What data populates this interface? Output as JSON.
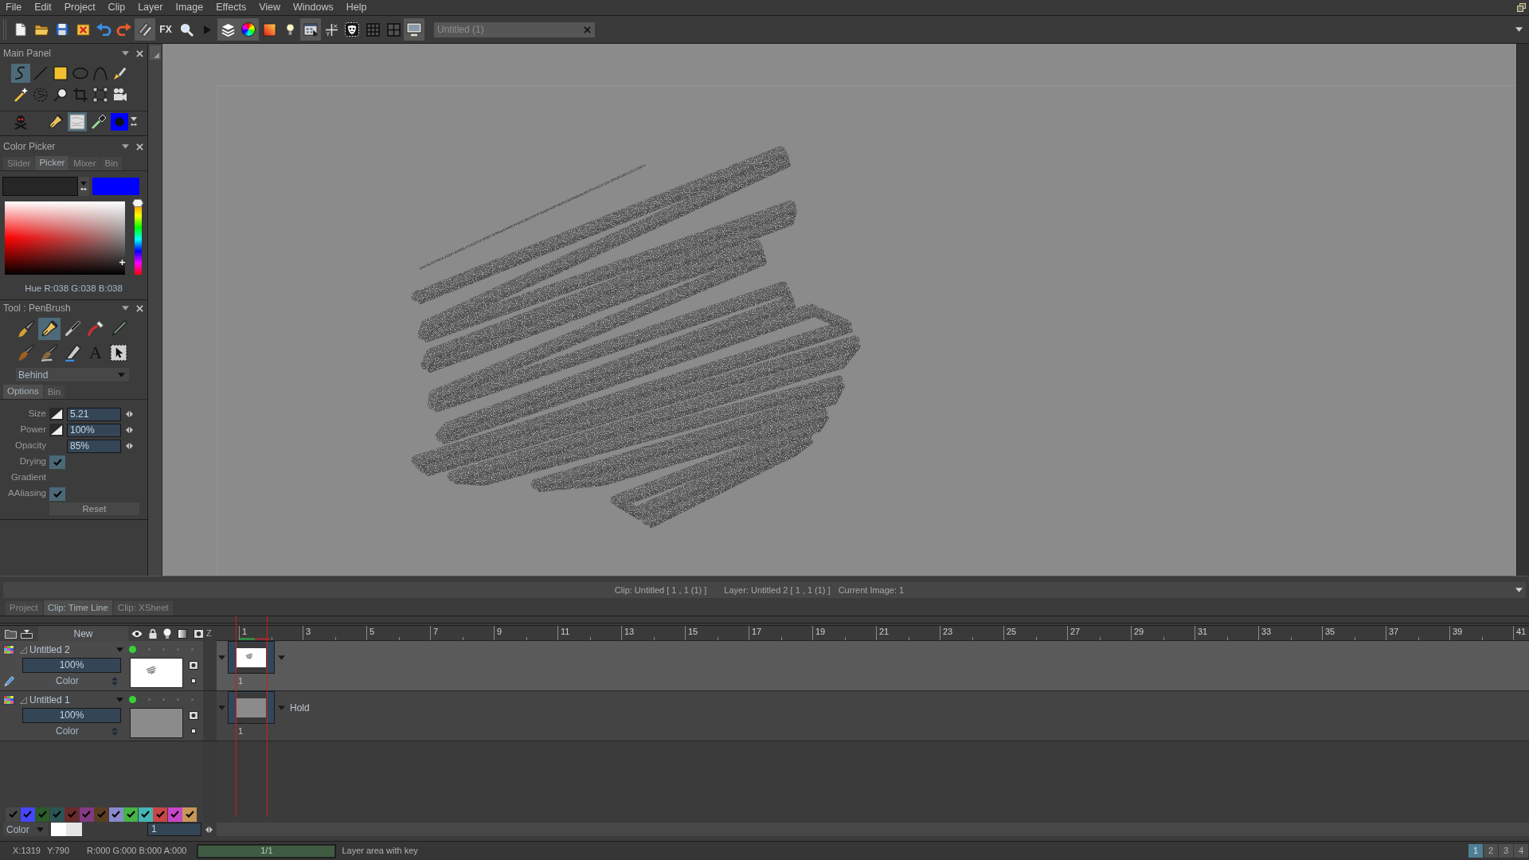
{
  "menu_bar": {
    "items": [
      "File",
      "Edit",
      "Project",
      "Clip",
      "Layer",
      "Image",
      "Effects",
      "View",
      "Windows",
      "Help"
    ]
  },
  "toolbar": {
    "buttons": [
      {
        "on": false
      },
      {
        "on": false
      },
      {
        "on": false
      },
      {
        "on": false
      },
      {
        "on": false
      },
      {
        "on": false
      },
      {
        "on": true
      },
      {
        "label": "FX",
        "on": false
      },
      {
        "on": false
      },
      {
        "on": false
      },
      {
        "on": true
      },
      {
        "on": true
      },
      {
        "on": false
      },
      {
        "on": false
      },
      {
        "on": true
      },
      {
        "on": false
      },
      {
        "on": false
      },
      {
        "on": false
      },
      {
        "on": false
      },
      {
        "on": true
      }
    ],
    "document_tab": {
      "title": "Untitled (1)"
    }
  },
  "main_panel": {
    "title": "Main Panel",
    "tool_rows": [
      [
        {
          "selected": true
        },
        {
          "selected": false
        },
        {
          "selected": false
        },
        {
          "selected": false
        },
        {
          "selected": false
        },
        {
          "selected": false
        }
      ],
      [
        {
          "selected": false
        },
        {
          "selected": false
        },
        {
          "selected": false
        },
        {
          "selected": false
        },
        {
          "selected": false
        },
        {
          "selected": false
        }
      ],
      [
        {
          "selected": false
        },
        {
          "selected": false
        },
        {
          "selected": true
        },
        {
          "selected": false
        },
        {
          "color": "#0000ff"
        }
      ]
    ]
  },
  "color_picker": {
    "title": "Color Picker",
    "tabs": [
      {
        "label": "Slider",
        "selected": false
      },
      {
        "label": "Picker",
        "selected": true
      },
      {
        "label": "Mixer",
        "selected": false
      },
      {
        "label": "Bin",
        "selected": false
      }
    ],
    "colors": [
      {
        "color": "#262626",
        "selected": true
      },
      {
        "color": "#0000ff",
        "selected": false
      }
    ],
    "hue_slider": {
      "level": 1
    },
    "readout": "Hue R:038 G:038 B:038"
  },
  "tool_panel": {
    "title": "Tool : PenBrush",
    "brush_rows": [
      [
        {
          "selected": false
        },
        {
          "selected": true
        },
        {
          "selected": false
        },
        {
          "selected": false
        },
        {
          "selected": false
        }
      ],
      [
        {
          "selected": false
        },
        {
          "selected": false
        },
        {
          "selected": false
        },
        {
          "label": "A",
          "selected": false
        },
        {
          "selected": false
        }
      ]
    ],
    "mode": "Behind",
    "tabs": [
      {
        "label": "Options",
        "selected": true
      },
      {
        "label": "Bin",
        "selected": false
      }
    ],
    "options": [
      {
        "kind": "field",
        "label": "Size",
        "value": "5.21",
        "pressure": true
      },
      {
        "kind": "field",
        "label": "Power",
        "value": "100%",
        "pressure": true
      },
      {
        "kind": "field",
        "label": "Opacity",
        "value": "85%",
        "pressure": false
      },
      {
        "kind": "checkbox",
        "label": "Drying",
        "checked": true
      },
      {
        "kind": "label",
        "label": "Gradient"
      },
      {
        "kind": "checkbox",
        "label": "AAliasing",
        "checked": true
      }
    ],
    "reset_button": "Reset"
  },
  "info_bar": {
    "clip": "Clip: Untitled [ 1 , 1 (1) ]",
    "layer": "Layer: Untitled 2 [ 1 , 1 (1) ]",
    "current_image": "Current Image: 1"
  },
  "panel_tabs": [
    {
      "label": "Project",
      "selected": false
    },
    {
      "label": "Clip: Time Line",
      "selected": true
    },
    {
      "label": "Clip: XSheet",
      "selected": false
    }
  ],
  "timeline": {
    "new_button": "New",
    "z_label": "Z",
    "ruler": [
      "1",
      "3",
      "5",
      "7",
      "9",
      "11",
      "13",
      "15",
      "17",
      "19",
      "21",
      "23",
      "25",
      "27",
      "29",
      "31",
      "33",
      "35",
      "37",
      "39",
      "41"
    ],
    "layers": [
      {
        "name": "Untitled 2",
        "selected": true,
        "visible": true,
        "locked": false,
        "light_table": false,
        "fade": false,
        "mask": false,
        "opacity": "100%",
        "blend_mode": "Color",
        "thumbnail": {
          "kind": "sketch"
        },
        "cells": [
          {
            "label": "1"
          }
        ]
      },
      {
        "name": "Untitled 1",
        "selected": false,
        "visible": true,
        "locked": false,
        "light_table": false,
        "fade": false,
        "mask": false,
        "opacity": "100%",
        "blend_mode": "Color",
        "thumbnail": {
          "kind": "solid"
        },
        "cells": [
          {
            "label": "1"
          }
        ],
        "hold": "Hold"
      }
    ],
    "color_filters": [
      {
        "color": "#474747",
        "checked": true
      },
      {
        "color": "#4646ff",
        "checked": true
      },
      {
        "color": "#2b5a2b",
        "checked": true
      },
      {
        "color": "#2b5555",
        "checked": true
      },
      {
        "color": "#6a2a2a",
        "checked": true
      },
      {
        "color": "#823a82",
        "checked": true
      },
      {
        "color": "#5a3e22",
        "checked": true
      },
      {
        "color": "#8a8acc",
        "checked": true
      },
      {
        "color": "#46b446",
        "checked": true
      },
      {
        "color": "#46b4b4",
        "checked": true
      },
      {
        "color": "#c84646",
        "checked": true
      },
      {
        "color": "#c846c8",
        "checked": true
      },
      {
        "color": "#c8965a",
        "checked": true
      }
    ],
    "color_mode": "Color",
    "frame_field": "1"
  },
  "status_bar": {
    "cursor_x": "X:1319",
    "cursor_y": "Y:790",
    "pixel": "R:000 G:000 B:000 A:000",
    "progress": {
      "label": "1/1",
      "level": 1
    },
    "message": "Layer area with key",
    "pages": [
      {
        "label": "1",
        "selected": true
      },
      {
        "label": "2",
        "selected": false
      },
      {
        "label": "3",
        "selected": false
      },
      {
        "label": "4",
        "selected": false
      }
    ]
  }
}
